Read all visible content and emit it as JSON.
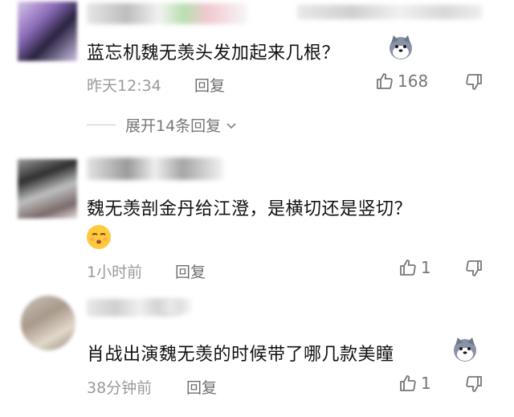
{
  "comments": [
    {
      "content": "蓝忘机魏无羡头发加起来几根？",
      "time": "昨天12:34",
      "reply_label": "回复",
      "like_count": "168",
      "emoji": "husky-emoji"
    },
    {
      "content": "魏无羡剖金丹给江澄，是横切还是竖切？",
      "time": "1小时前",
      "reply_label": "回复",
      "like_count": "1",
      "emoji": "pensive-face-emoji"
    },
    {
      "content": "肖战出演魏无羡的时候带了哪几款美瞳",
      "time": "38分钟前",
      "reply_label": "回复",
      "like_count": "1",
      "emoji": "husky-emoji"
    }
  ],
  "expand": {
    "label": "展开14条回复"
  },
  "icons": {
    "like": "thumbs-up-icon",
    "dislike": "thumbs-down-icon",
    "chevron": "chevron-down-icon"
  },
  "colors": {
    "text": "#111111",
    "meta": "#9a9a9a",
    "icon": "#777777"
  }
}
